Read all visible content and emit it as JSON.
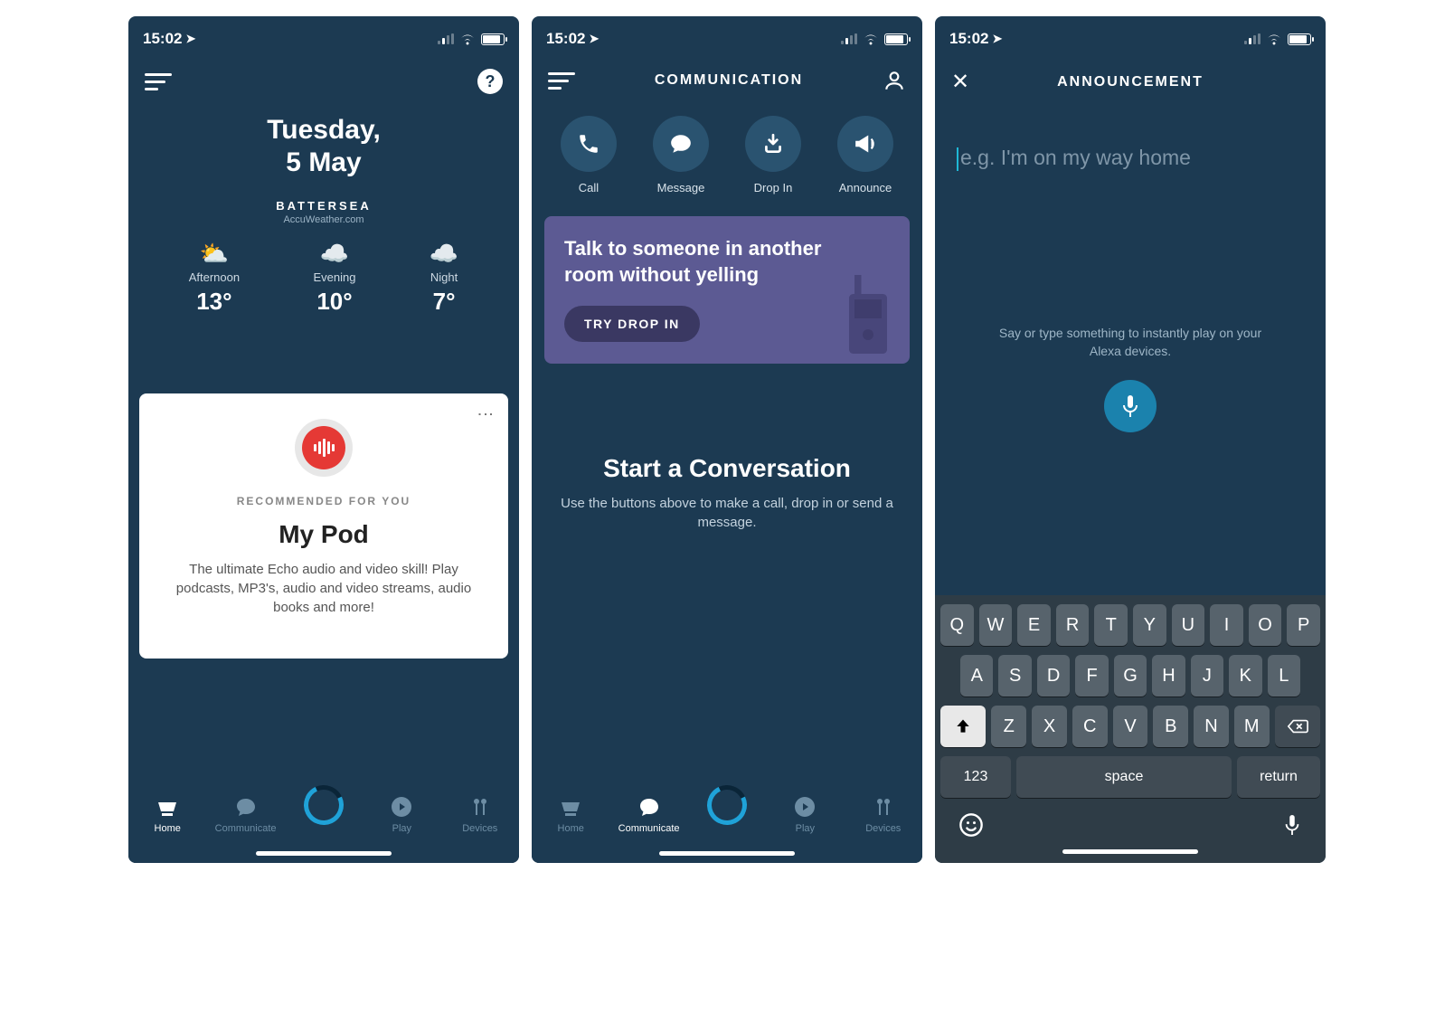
{
  "status": {
    "time": "15:02"
  },
  "screen1": {
    "date_line1": "Tuesday,",
    "date_line2": "5 May",
    "location": "BATTERSEA",
    "source": "AccuWeather.com",
    "weather": [
      {
        "label": "Afternoon",
        "temp": "13°"
      },
      {
        "label": "Evening",
        "temp": "10°"
      },
      {
        "label": "Night",
        "temp": "7°"
      }
    ],
    "card": {
      "eyebrow": "RECOMMENDED FOR YOU",
      "title": "My Pod",
      "desc": "The ultimate Echo audio and video skill! Play podcasts, MP3's, audio and video streams, audio books and more!"
    },
    "tabs": [
      "Home",
      "Communicate",
      "",
      "Play",
      "Devices"
    ],
    "active_tab": 0
  },
  "screen2": {
    "title": "COMMUNICATION",
    "quick": [
      {
        "label": "Call"
      },
      {
        "label": "Message"
      },
      {
        "label": "Drop In"
      },
      {
        "label": "Announce"
      }
    ],
    "promo_title": "Talk to someone in another room without yelling",
    "promo_cta": "TRY DROP IN",
    "convo_title": "Start a Conversation",
    "convo_body": "Use the buttons above to make a call, drop in or send a message.",
    "tabs": [
      "Home",
      "Communicate",
      "",
      "Play",
      "Devices"
    ],
    "active_tab": 1
  },
  "screen3": {
    "title": "ANNOUNCEMENT",
    "placeholder": "e.g. I'm on my way home",
    "hint": "Say or type something to instantly play on your Alexa devices.",
    "keyboard": {
      "row1": [
        "Q",
        "W",
        "E",
        "R",
        "T",
        "Y",
        "U",
        "I",
        "O",
        "P"
      ],
      "row2": [
        "A",
        "S",
        "D",
        "F",
        "G",
        "H",
        "J",
        "K",
        "L"
      ],
      "row3": [
        "Z",
        "X",
        "C",
        "V",
        "B",
        "N",
        "M"
      ],
      "num": "123",
      "space": "space",
      "return": "return"
    }
  }
}
